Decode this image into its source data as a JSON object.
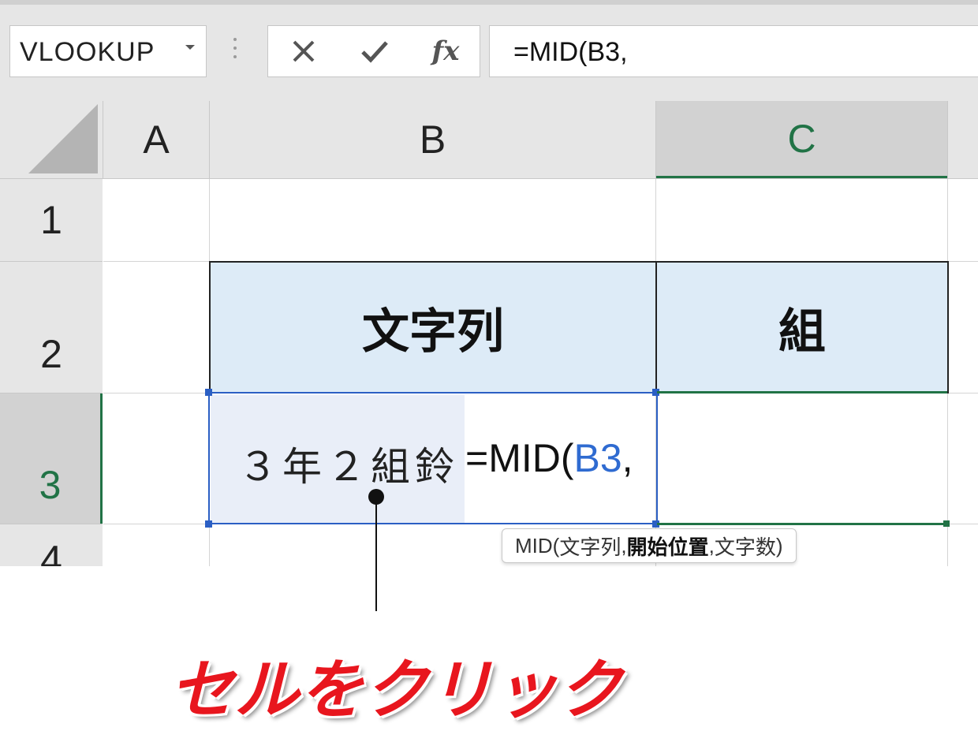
{
  "formula_bar": {
    "name_box": "VLOOKUP",
    "cancel_icon": "x-icon",
    "enter_icon": "check-icon",
    "fx_label": "fx",
    "formula": "=MID(B3,"
  },
  "columns": [
    "A",
    "B",
    "C"
  ],
  "rows": [
    "1",
    "2",
    "3",
    "4"
  ],
  "cells": {
    "B2": "文字列",
    "C2": "組",
    "B3": "３年２組鈴"
  },
  "editor": {
    "prefix": "=MID(",
    "ref": "B3",
    "suffix": ","
  },
  "tooltip": {
    "fn": "MID(",
    "arg1": "文字列",
    "sep1": ", ",
    "arg2": "開始位置",
    "sep2": ", ",
    "arg3": "文字数",
    "close": ")"
  },
  "annotation": {
    "text": "セルをクリック"
  },
  "colors": {
    "selection": "#2b5fc4",
    "header_fill": "#ddebf7",
    "excel_green": "#217346",
    "callout_red": "#e8161e"
  }
}
